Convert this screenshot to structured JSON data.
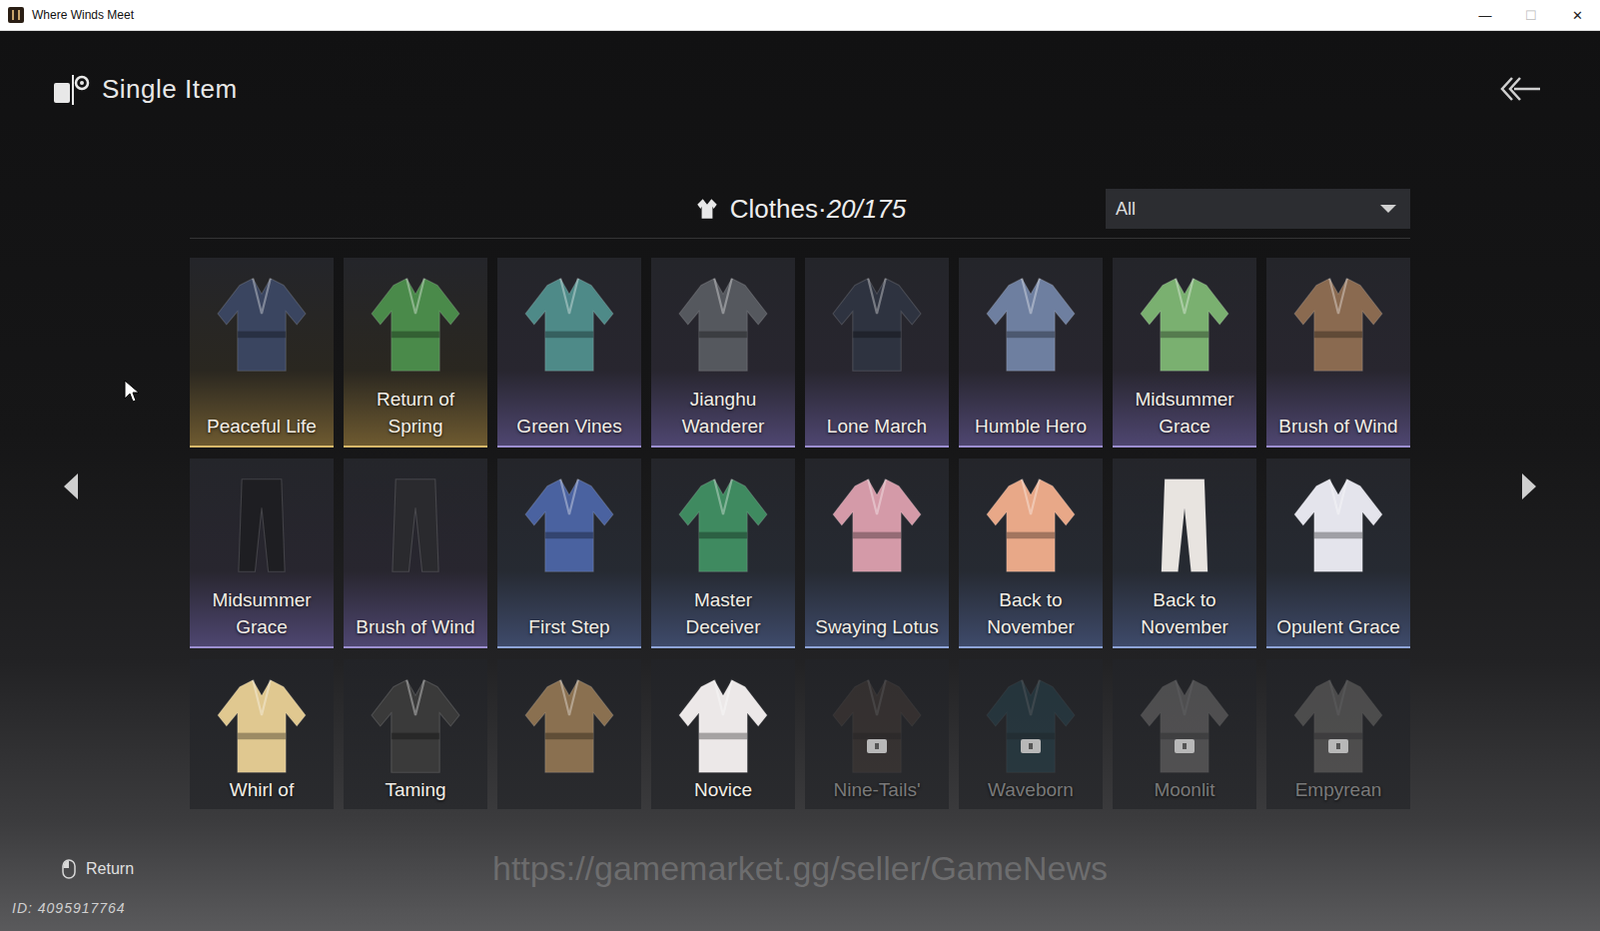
{
  "window": {
    "title": "Where Winds Meet",
    "controls": [
      {
        "glyph": "—",
        "disabled": false
      },
      {
        "glyph": "☐",
        "disabled": true
      },
      {
        "glyph": "✕",
        "disabled": false
      }
    ]
  },
  "header": {
    "title": "Single Item"
  },
  "category": {
    "label": "Clothes·",
    "count": "20/175"
  },
  "filter": {
    "value": "All"
  },
  "items": [
    {
      "name": "Peaceful Life",
      "rarity": "gold",
      "kind": "top",
      "color": "#3a4560",
      "locked": false
    },
    {
      "name": "Return of Spring",
      "rarity": "gold",
      "kind": "top",
      "color": "#4a8a4a",
      "locked": false
    },
    {
      "name": "Green Vines",
      "rarity": "purple",
      "kind": "top",
      "color": "#4e8a88",
      "locked": false
    },
    {
      "name": "Jianghu Wanderer",
      "rarity": "purple",
      "kind": "top",
      "color": "#55585e",
      "locked": false
    },
    {
      "name": "Lone March",
      "rarity": "purple",
      "kind": "top",
      "color": "#2e3340",
      "locked": false
    },
    {
      "name": "Humble Hero",
      "rarity": "purple",
      "kind": "top",
      "color": "#6e7fa0",
      "locked": false
    },
    {
      "name": "Midsummer Grace",
      "rarity": "purple",
      "kind": "top",
      "color": "#7ab070",
      "locked": false
    },
    {
      "name": "Brush of Wind",
      "rarity": "purple",
      "kind": "top",
      "color": "#8a6a50",
      "locked": false
    },
    {
      "name": "Midsummer Grace",
      "rarity": "purple",
      "kind": "pants",
      "color": "#1e1e22",
      "locked": false
    },
    {
      "name": "Brush of Wind",
      "rarity": "purple",
      "kind": "pants",
      "color": "#2a2a2e",
      "locked": false
    },
    {
      "name": "First Step",
      "rarity": "blue",
      "kind": "top",
      "color": "#4a62a0",
      "locked": false
    },
    {
      "name": "Master Deceiver",
      "rarity": "blue",
      "kind": "top",
      "color": "#3f8a60",
      "locked": false
    },
    {
      "name": "Swaying Lotus",
      "rarity": "blue",
      "kind": "top",
      "color": "#d49aa8",
      "locked": false
    },
    {
      "name": "Back to November",
      "rarity": "blue",
      "kind": "top",
      "color": "#e8a888",
      "locked": false
    },
    {
      "name": "Back to November",
      "rarity": "blue",
      "kind": "pants",
      "color": "#e8e4e0",
      "locked": false
    },
    {
      "name": "Opulent Grace",
      "rarity": "blue",
      "kind": "top",
      "color": "#e4e4ec",
      "locked": false
    },
    {
      "name": "Whirl of",
      "rarity": "none",
      "kind": "top",
      "color": "#e0c890",
      "locked": false
    },
    {
      "name": "Taming",
      "rarity": "none",
      "kind": "top",
      "color": "#3a3a3a",
      "locked": false
    },
    {
      "name": "",
      "rarity": "none",
      "kind": "top",
      "color": "#8a7050",
      "locked": false
    },
    {
      "name": "Novice",
      "rarity": "none",
      "kind": "top",
      "color": "#ece8e8",
      "locked": false
    },
    {
      "name": "Nine-Tails'",
      "rarity": "none",
      "kind": "top",
      "color": "#5a4a40",
      "locked": true
    },
    {
      "name": "Waveborn",
      "rarity": "none",
      "kind": "top",
      "color": "#2a5a6a",
      "locked": true
    },
    {
      "name": "Moonlit",
      "rarity": "none",
      "kind": "top",
      "color": "#b0aca8",
      "locked": true
    },
    {
      "name": "Empyrean",
      "rarity": "none",
      "kind": "top",
      "color": "#a8a49c",
      "locked": true
    }
  ],
  "footer": {
    "return": "Return",
    "id": "ID: 4095917764"
  },
  "watermark": "https://gamemarket.gg/seller/GameNews"
}
